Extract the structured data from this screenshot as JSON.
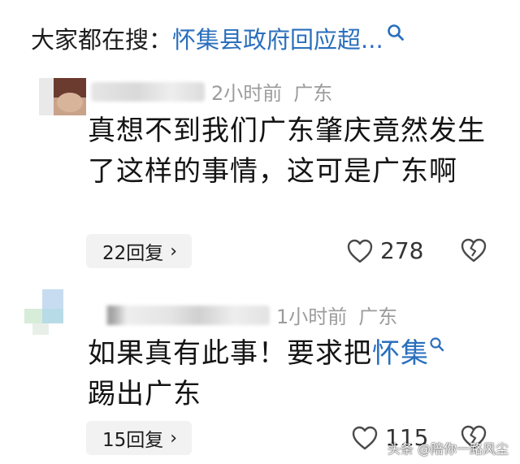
{
  "search": {
    "prefix": "大家都在搜：",
    "query": "怀集县政府回应超...",
    "icon": "search-icon"
  },
  "comments": [
    {
      "time": "2小时前",
      "location": "广东",
      "text": "真想不到我们广东肇庆竟然发生了这样的事情，这可是广东啊",
      "replies": "22回复",
      "likes": "278"
    },
    {
      "time": "1小时前",
      "location": "广东",
      "text_before": "如果真有此事！要求把",
      "text_link": "怀集",
      "text_after": "踢出广东",
      "replies": "15回复",
      "likes": "115"
    }
  ],
  "watermark": "头条 @陪你一路风尘",
  "colors": {
    "accent": "#2a6fbd",
    "muted": "#9c9c9c",
    "reply_bg": "#f2f2f2"
  }
}
